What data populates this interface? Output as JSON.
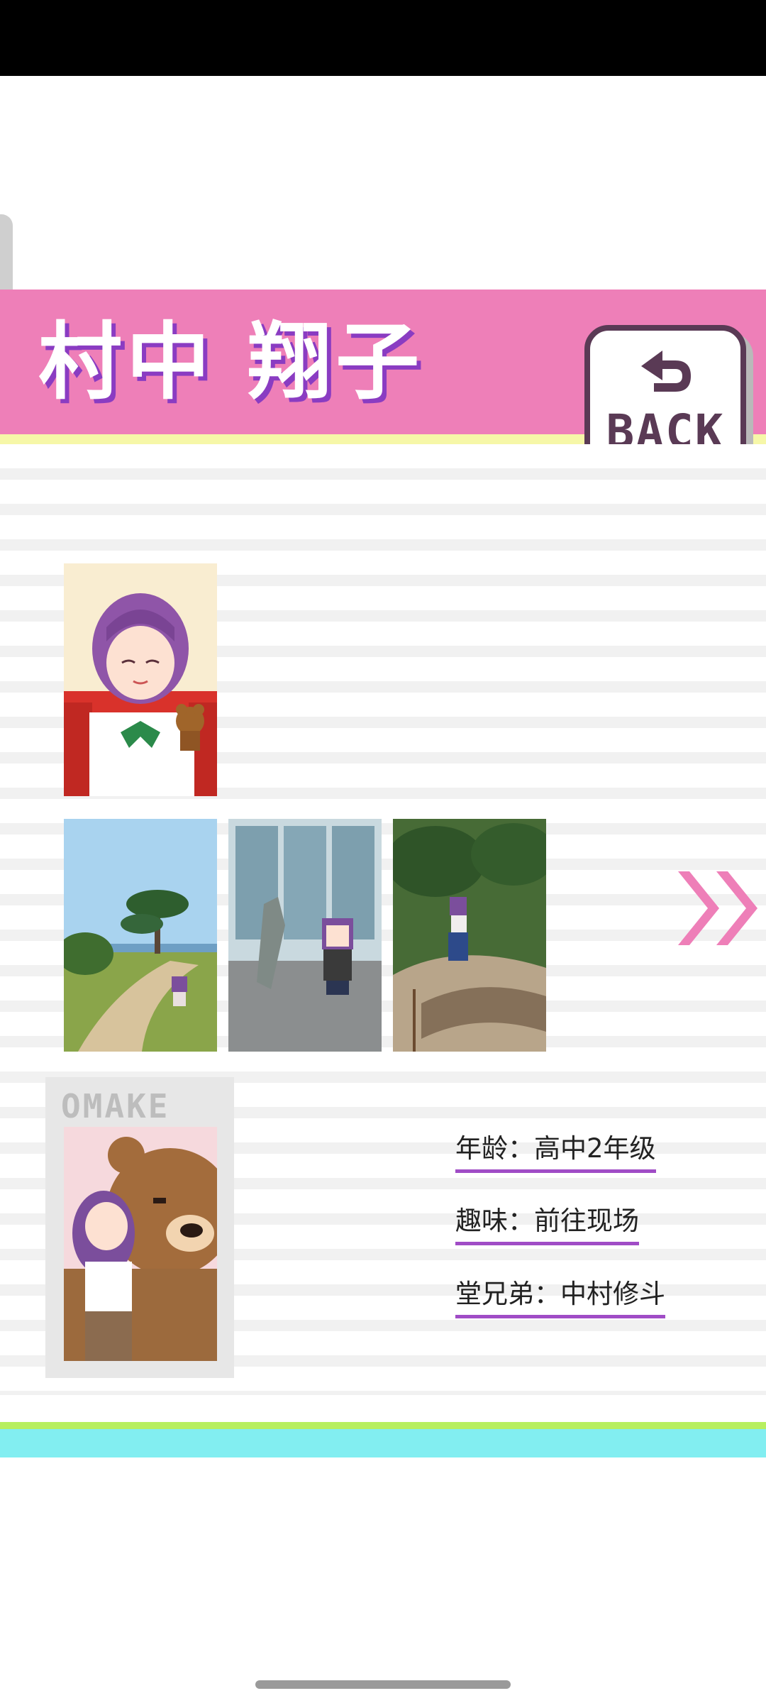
{
  "character": {
    "name": "村中 翔子"
  },
  "back_button": {
    "label": "BACK"
  },
  "omake": {
    "label": "OMAKE"
  },
  "profile": [
    {
      "label": "年龄",
      "value": "高中2年级"
    },
    {
      "label": "趣味",
      "value": "前往现场"
    },
    {
      "label": "堂兄弟",
      "value": "中村修斗"
    }
  ],
  "icons": {
    "back": "return-arrow-icon",
    "next": "double-chevron-right-icon"
  },
  "colors": {
    "title_band": "#ee7fb8",
    "title_shadow": "#8a3cc2",
    "accent_underline": "#a04cc6",
    "footer_cyan": "#82eef1",
    "footer_green": "#b7ef5f"
  }
}
